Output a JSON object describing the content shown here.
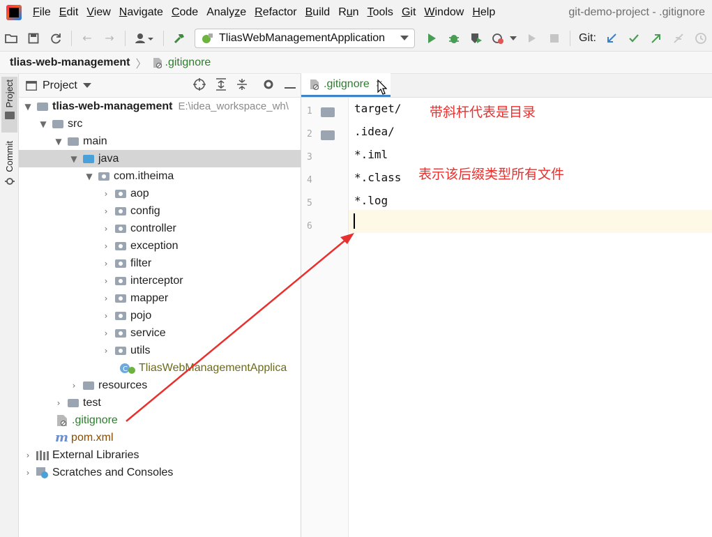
{
  "menubar": {
    "items": [
      "File",
      "Edit",
      "View",
      "Navigate",
      "Code",
      "Analyze",
      "Refactor",
      "Build",
      "Run",
      "Tools",
      "Git",
      "Window",
      "Help"
    ],
    "mnemonics": [
      "F",
      "E",
      "V",
      "N",
      "C",
      "z",
      "R",
      "B",
      "u",
      "T",
      "G",
      "W",
      "H"
    ],
    "window_title": "git-demo-project - .gitignore"
  },
  "toolbar": {
    "run_config": "TliasWebManagementApplication",
    "git_label": "Git:"
  },
  "breadcrumb": {
    "root": "tlias-web-management",
    "file": ".gitignore"
  },
  "side_strip": {
    "project_tab": "Project",
    "commit_tab": "Commit"
  },
  "project_panel": {
    "title": "Project",
    "tree": [
      {
        "label": "tlias-web-management",
        "path": "E:\\idea_workspace_wh\\"
      },
      {
        "label": "src"
      },
      {
        "label": "main"
      },
      {
        "label": "java"
      },
      {
        "label": "com.itheima"
      },
      {
        "label": "aop"
      },
      {
        "label": "config"
      },
      {
        "label": "controller"
      },
      {
        "label": "exception"
      },
      {
        "label": "filter"
      },
      {
        "label": "interceptor"
      },
      {
        "label": "mapper"
      },
      {
        "label": "pojo"
      },
      {
        "label": "service"
      },
      {
        "label": "utils"
      },
      {
        "label": "TliasWebManagementApplica"
      },
      {
        "label": "resources"
      },
      {
        "label": "test"
      },
      {
        "label": ".gitignore"
      },
      {
        "label": "pom.xml"
      },
      {
        "label": "External Libraries"
      },
      {
        "label": "Scratches and Consoles"
      }
    ]
  },
  "editor": {
    "tab_label": ".gitignore",
    "line_numbers": [
      "1",
      "2",
      "3",
      "4",
      "5",
      "6"
    ],
    "lines": [
      "target/",
      ".idea/",
      "*.iml",
      "*.class",
      "*.log",
      ""
    ]
  },
  "annotations": {
    "directory_note": "带斜杆代表是目录",
    "suffix_note": "表示该后缀类型所有文件"
  },
  "colors": {
    "annotation": "#e8302e",
    "git_file": "#2d7d2d",
    "tab_underline": "#4083c9",
    "selection": "#d5d5d5"
  }
}
